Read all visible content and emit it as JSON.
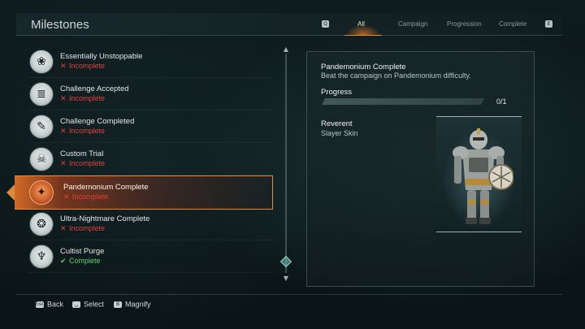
{
  "header": {
    "title": "Milestones",
    "left_key": "Q",
    "right_key": "E",
    "tabs": [
      {
        "label": "All",
        "active": true
      },
      {
        "label": "Campaign",
        "active": false
      },
      {
        "label": "Progression",
        "active": false
      },
      {
        "label": "Complete",
        "active": false
      }
    ]
  },
  "milestones": [
    {
      "name": "Essentially Unstoppable",
      "status": "Incomplete",
      "icon": "triple-emblem-icon",
      "glyph": "❀"
    },
    {
      "name": "Challenge Accepted",
      "status": "Incomplete",
      "icon": "scroll-icon",
      "glyph": "≣"
    },
    {
      "name": "Challenge Completed",
      "status": "Incomplete",
      "icon": "scroll-quill-icon",
      "glyph": "✎"
    },
    {
      "name": "Custom Trial",
      "status": "Incomplete",
      "icon": "skull-crossbones-icon",
      "glyph": "☠"
    },
    {
      "name": "Pandemonium Complete",
      "status": "Incomplete",
      "icon": "demon-crest-icon",
      "glyph": "✦",
      "selected": true
    },
    {
      "name": "Ultra-Nightmare Complete",
      "status": "Incomplete",
      "icon": "nightmare-crest-icon",
      "glyph": "❂"
    },
    {
      "name": "Cultist Purge",
      "status": "Complete",
      "icon": "hooded-cultist-icon",
      "glyph": "♆"
    }
  ],
  "status_marks": {
    "Incomplete": "✕",
    "Complete": "✔"
  },
  "detail": {
    "title": "Pandemonium Complete",
    "description": "Beat the campaign on Pandemonium difficulty.",
    "progress_label": "Progress",
    "progress_text": "0/1",
    "progress_fraction": 0,
    "reward_name": "Reverent",
    "reward_type": "Slayer Skin"
  },
  "footer": {
    "hints": [
      {
        "key": "Esc",
        "label": "Back"
      },
      {
        "key": "␣",
        "label": "Select"
      },
      {
        "key": "B",
        "label": "Magnify"
      }
    ]
  },
  "colors": {
    "accent": "#e0893a",
    "incomplete": "#e0413c",
    "complete": "#5fd06a"
  }
}
